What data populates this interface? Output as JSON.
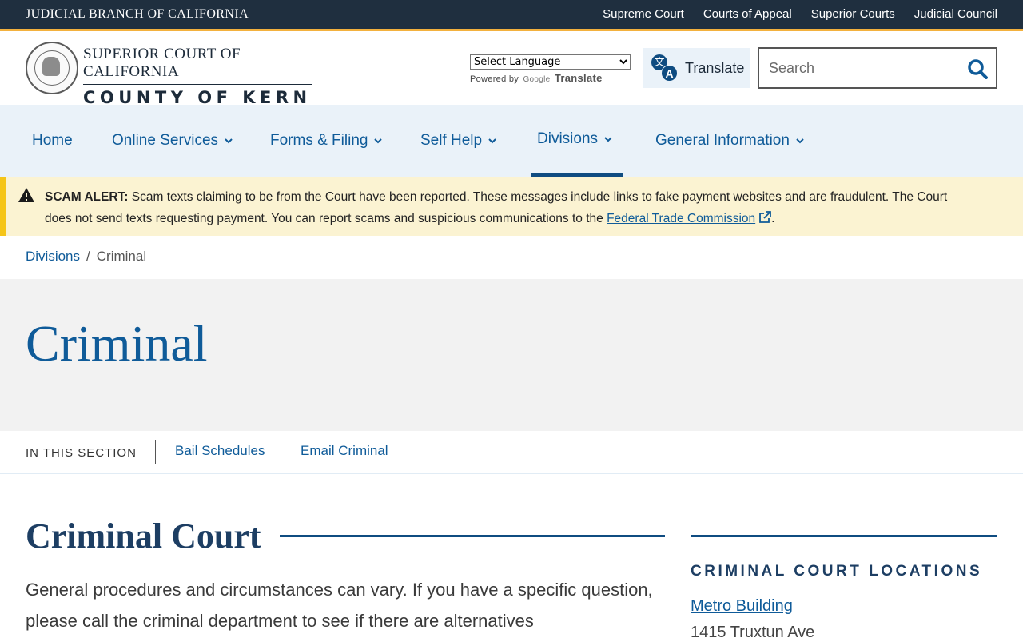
{
  "topbar": {
    "brand": "JUDICIAL BRANCH OF CALIFORNIA",
    "links": [
      "Supreme Court",
      "Courts of Appeal",
      "Superior Courts",
      "Judicial Council"
    ]
  },
  "header": {
    "logo_line1": "SUPERIOR COURT OF CALIFORNIA",
    "logo_line2": "COUNTY OF KERN",
    "language_select": "Select Language",
    "powered_by": "Powered by",
    "google": "Google",
    "google_translate": "Translate",
    "translate_button": "Translate",
    "search_placeholder": "Search"
  },
  "nav": {
    "items": [
      {
        "label": "Home",
        "dropdown": false
      },
      {
        "label": "Online Services",
        "dropdown": true
      },
      {
        "label": "Forms & Filing",
        "dropdown": true
      },
      {
        "label": "Self Help",
        "dropdown": true
      },
      {
        "label": "Divisions",
        "dropdown": true,
        "active": true
      },
      {
        "label": "General Information",
        "dropdown": true
      }
    ]
  },
  "alert": {
    "title": "SCAM ALERT:",
    "text": "Scam texts claiming to be from the Court have been reported. These messages include links to fake payment websites and are fraudulent. The Court does not send texts requesting payment. You can report scams and suspicious communications to the",
    "link": "Federal Trade Commission",
    "end": "."
  },
  "breadcrumb": {
    "parent": "Divisions",
    "separator": "/",
    "current": "Criminal"
  },
  "hero": {
    "title": "Criminal"
  },
  "section_nav": {
    "label": "IN THIS SECTION",
    "links": [
      "Bail Schedules",
      "Email Criminal"
    ]
  },
  "content": {
    "title": "Criminal Court",
    "body": "General procedures and circumstances can vary. If you have a specific question, please call the criminal department to see if there are alternatives"
  },
  "sidebar": {
    "title": "CRIMINAL COURT LOCATIONS",
    "location_name": "Metro Building",
    "location_address": "1415 Truxtun Ave"
  },
  "colors": {
    "topbar": "#1f2f3f",
    "accent_gold": "#f3b13e",
    "nav_bg": "#eaf2f9",
    "link_blue": "#0f5b99",
    "alert_bg": "#fbf3d2",
    "alert_border": "#f5c518"
  }
}
